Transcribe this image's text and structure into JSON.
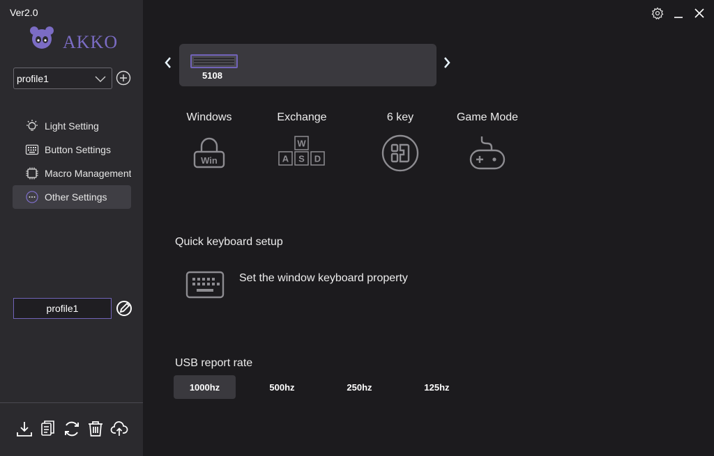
{
  "app": {
    "version": "Ver2.0",
    "brand": "AKKO"
  },
  "colors": {
    "accent": "#7163b9",
    "sidebar": "#2b2a2e",
    "main": "#1c1b1e"
  },
  "profile_selector": {
    "value": "profile1"
  },
  "nav": {
    "items": [
      {
        "label": "Light Setting",
        "icon": "bulb-icon"
      },
      {
        "label": "Button Settings",
        "icon": "keyboard-grid-icon"
      },
      {
        "label": "Macro Management",
        "icon": "chip-icon"
      },
      {
        "label": "Other Settings",
        "icon": "dots-circle-icon",
        "active": true
      }
    ]
  },
  "profile_name": "profile1",
  "device": {
    "name": "5108"
  },
  "modes": [
    {
      "label": "Windows",
      "icon": "win-lock-icon",
      "badge": "Win"
    },
    {
      "label": "Exchange",
      "icon": "wasd-icon",
      "keys": [
        "W",
        "A",
        "S",
        "D"
      ]
    },
    {
      "label": "6 key",
      "icon": "six-key-icon"
    },
    {
      "label": "Game Mode",
      "icon": "gamepad-icon"
    }
  ],
  "quick_setup": {
    "title": "Quick keyboard setup",
    "action": "Set the window keyboard property"
  },
  "usb": {
    "title": "USB report rate",
    "rates": [
      "1000hz",
      "500hz",
      "250hz",
      "125hz"
    ],
    "selected": "1000hz"
  }
}
